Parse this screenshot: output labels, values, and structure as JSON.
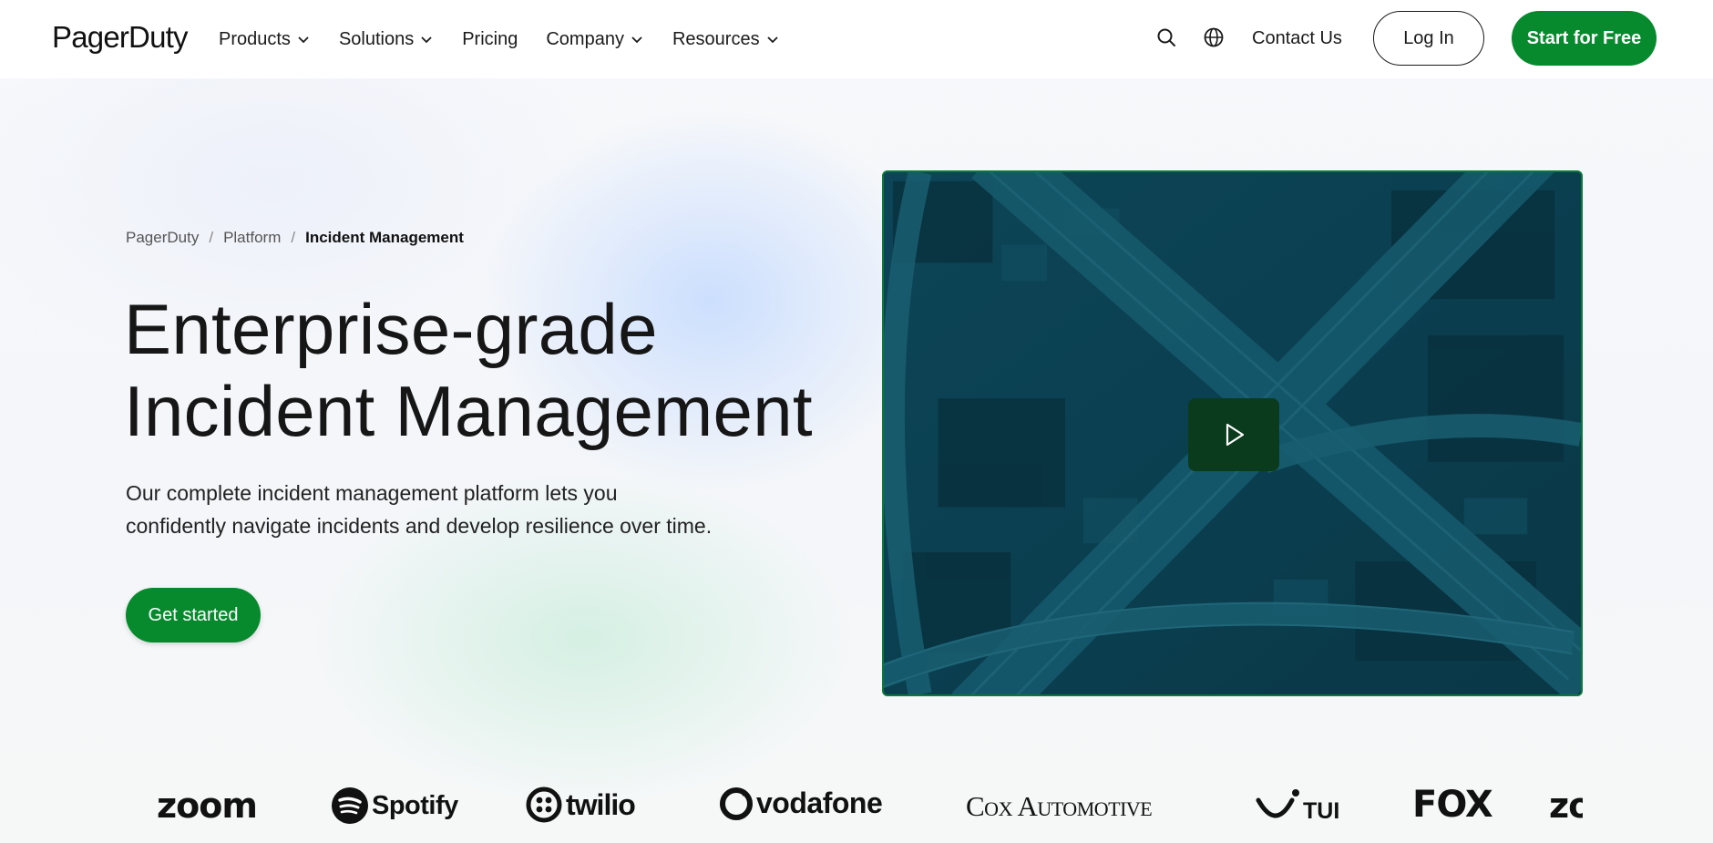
{
  "brand": {
    "name": "PagerDuty",
    "accent": "#068a2d"
  },
  "nav": {
    "links": [
      {
        "label": "Products",
        "dropdown": true
      },
      {
        "label": "Solutions",
        "dropdown": true
      },
      {
        "label": "Pricing",
        "dropdown": false
      },
      {
        "label": "Company",
        "dropdown": true
      },
      {
        "label": "Resources",
        "dropdown": true
      }
    ],
    "search_icon": "search-icon",
    "language_icon": "globe-icon",
    "contact": "Contact Us",
    "login": "Log In",
    "start": "Start for Free"
  },
  "breadcrumb": [
    "PagerDuty",
    "Platform",
    "Incident Management"
  ],
  "hero": {
    "title_line1": "Enterprise-grade",
    "title_line2": "Incident Management",
    "description_line1": "Our complete incident management platform lets you",
    "description_line2": "confidently navigate incidents and develop resilience over time.",
    "cta": "Get started"
  },
  "video": {
    "play_icon": "play-icon"
  },
  "customer_logos": [
    "zoom",
    "Spotify",
    "twilio",
    "vodafone",
    "Cox Automotive",
    "TUI",
    "FOX",
    "zoom"
  ]
}
